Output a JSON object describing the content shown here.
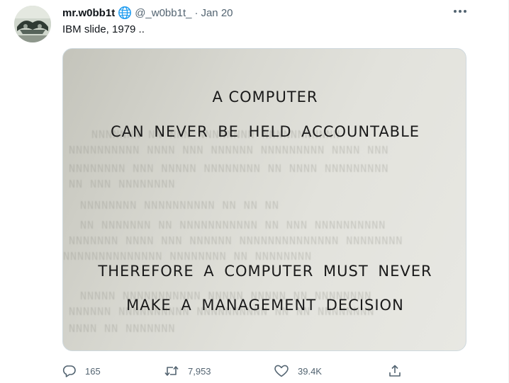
{
  "tweet": {
    "author": {
      "display_name": "mr.w0bb1t",
      "handle": "@_w0bb1t_",
      "verified_icon": "globe-icon"
    },
    "separator": "·",
    "date": "Jan 20",
    "text": "IBM slide, 1979 ..",
    "more_icon": "more-horizontal-icon",
    "media": {
      "slide_lines": [
        "A COMPUTER",
        "CAN NEVER BE HELD ACCOUNTABLE",
        "THEREFORE A COMPUTER MUST NEVER",
        "MAKE A MANAGEMENT DECISION"
      ]
    },
    "actions": {
      "reply_count": "165",
      "retweet_count": "7,953",
      "like_count": "39.4K"
    },
    "colors": {
      "text": "#0f1419",
      "secondary": "#536471",
      "verified_accent": "#1d9bf0",
      "border": "#cfd9de"
    }
  }
}
